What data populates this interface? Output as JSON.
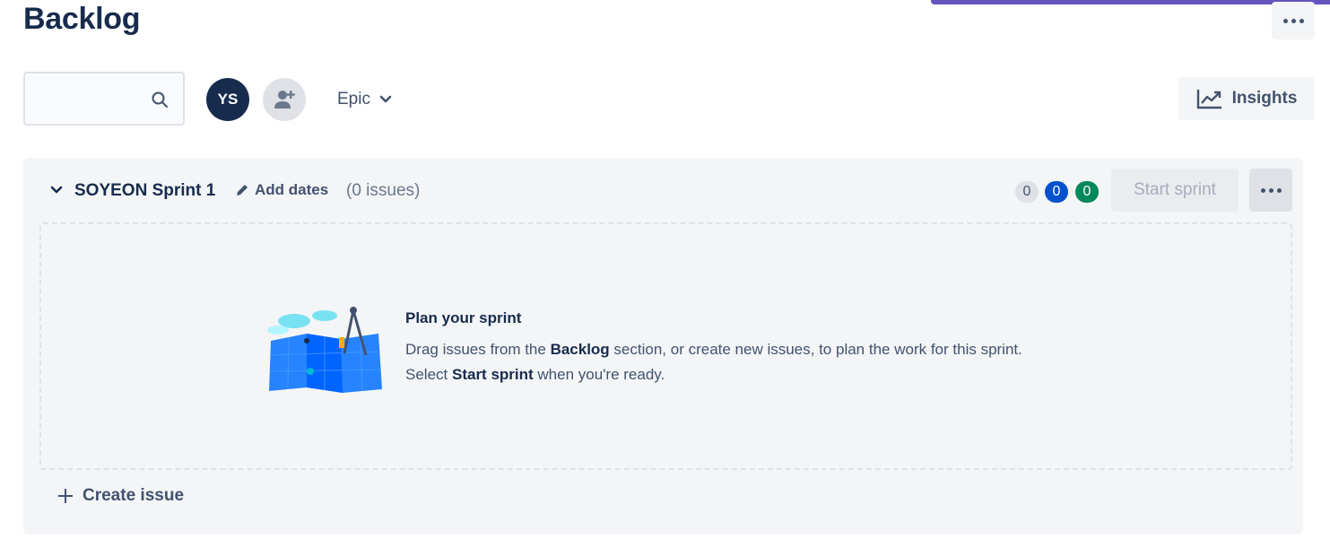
{
  "page": {
    "title": "Backlog"
  },
  "toolbar": {
    "search_placeholder": "",
    "avatar_initials": "YS",
    "epic_label": "Epic",
    "insights_label": "Insights"
  },
  "sprint": {
    "name": "SOYEON Sprint 1",
    "add_dates_label": "Add dates",
    "issue_count": "(0 issues)",
    "status_counts": {
      "todo": "0",
      "in_progress": "0",
      "done": "0"
    },
    "start_sprint_label": "Start sprint",
    "empty_state": {
      "title": "Plan your sprint",
      "body_1": "Drag issues from the ",
      "body_bold_1": "Backlog",
      "body_2": " section, or create new issues, to plan the work for this sprint. Select ",
      "body_bold_2": "Start sprint",
      "body_3": " when you're ready."
    },
    "create_issue_label": "Create issue"
  },
  "colors": {
    "accent": "#6554c0",
    "in_progress": "#0052cc",
    "done": "#00875a",
    "text": "#172b4d"
  }
}
